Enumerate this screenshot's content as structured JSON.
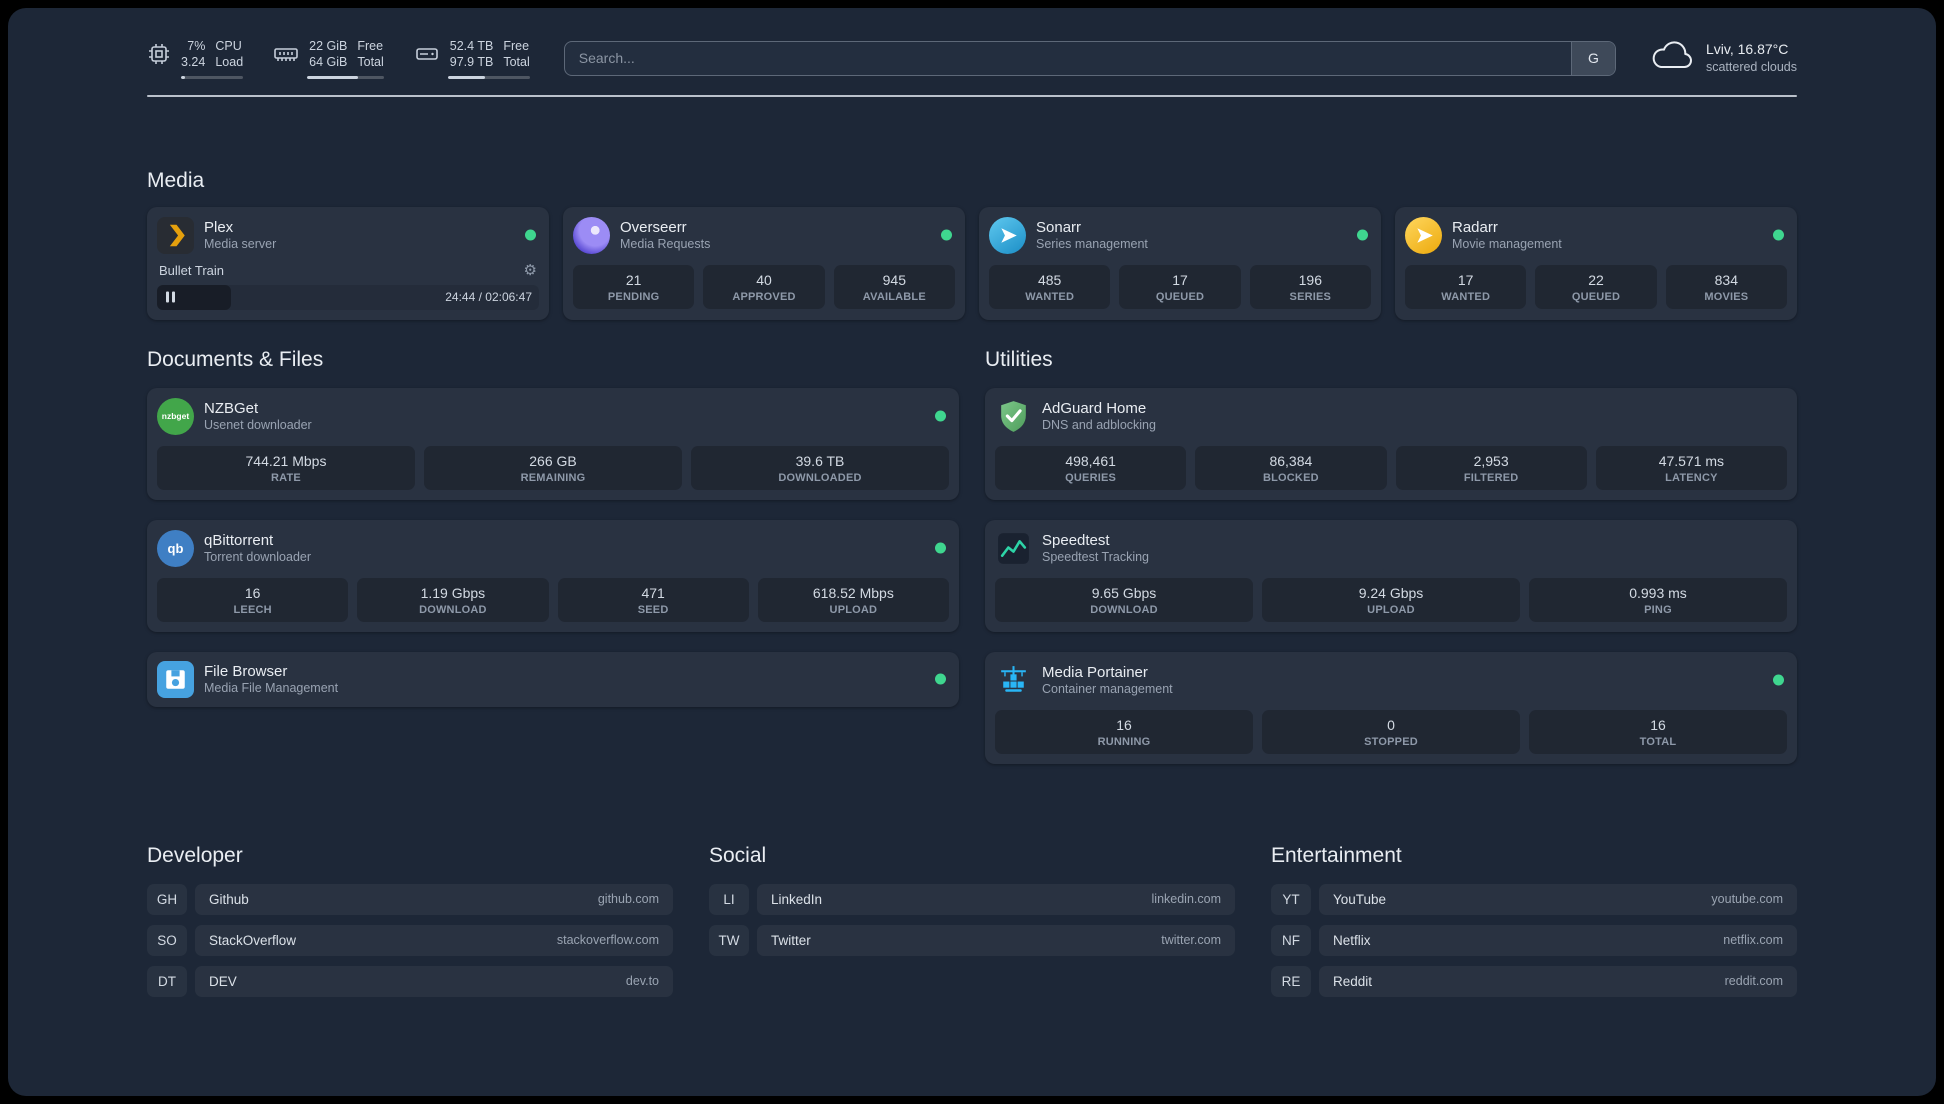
{
  "colors": {
    "background": "#1d2737",
    "card": "rgba(255,255,255,0.055)",
    "stat_box": "rgba(0,0,0,0.22)",
    "status_online": "#3fd68f",
    "text_primary": "#e9edf2",
    "text_secondary": "#99a3b2",
    "plex_amber": "#e5a00d",
    "overseerr_purple": "#5b4bd4",
    "sonarr_blue": "#35c5f4",
    "radarr_gold": "#f0b313",
    "nzbget_green": "#42a64a",
    "qbittorrent_blue": "#3f7fc4",
    "filebrowser_blue": "#46a2e0",
    "adguard_green": "#68bc71",
    "speedtest_green": "#2dd4a7",
    "portainer_blue": "#29b6f6"
  },
  "icons": {
    "cpu": "cpu-chip",
    "memory": "ram-stick",
    "disk": "hard-drive",
    "weather": "cloud",
    "settings": "gear",
    "pause": "pause-bars",
    "status": "green-dot",
    "nzbget_text": "nzbget",
    "qb_text": "qb"
  },
  "topbar": {
    "cpu": {
      "value1": "7%",
      "value2": "3.24",
      "label1": "CPU",
      "label2": "Load",
      "bar_pct": 7
    },
    "memory": {
      "value1": "22 GiB",
      "value2": "64 GiB",
      "label1": "Free",
      "label2": "Total",
      "bar_pct": 66
    },
    "disk": {
      "value1": "52.4 TB",
      "value2": "97.9 TB",
      "label1": "Free",
      "label2": "Total",
      "bar_pct": 46
    },
    "search": {
      "placeholder": "Search...",
      "button_label": "G"
    },
    "weather": {
      "location": "Lviv, 16.87°C",
      "condition": "scattered clouds"
    }
  },
  "sections": {
    "media": {
      "title": "Media",
      "plex": {
        "name": "Plex",
        "desc": "Media server",
        "status": "online",
        "player": {
          "title": "Bullet Train",
          "time": "24:44 / 02:06:47",
          "progress_pct": 19.5
        }
      },
      "overseerr": {
        "name": "Overseerr",
        "desc": "Media Requests",
        "status": "online",
        "stats": [
          {
            "value": "21",
            "label": "PENDING"
          },
          {
            "value": "40",
            "label": "APPROVED"
          },
          {
            "value": "945",
            "label": "AVAILABLE"
          }
        ]
      },
      "sonarr": {
        "name": "Sonarr",
        "desc": "Series management",
        "status": "online",
        "stats": [
          {
            "value": "485",
            "label": "WANTED"
          },
          {
            "value": "17",
            "label": "QUEUED"
          },
          {
            "value": "196",
            "label": "SERIES"
          }
        ]
      },
      "radarr": {
        "name": "Radarr",
        "desc": "Movie management",
        "status": "online",
        "stats": [
          {
            "value": "17",
            "label": "WANTED"
          },
          {
            "value": "22",
            "label": "QUEUED"
          },
          {
            "value": "834",
            "label": "MOVIES"
          }
        ]
      }
    },
    "documents": {
      "title": "Documents & Files",
      "nzbget": {
        "name": "NZBGet",
        "desc": "Usenet downloader",
        "status": "online",
        "stats": [
          {
            "value": "744.21 Mbps",
            "label": "RATE"
          },
          {
            "value": "266 GB",
            "label": "REMAINING"
          },
          {
            "value": "39.6 TB",
            "label": "DOWNLOADED"
          }
        ]
      },
      "qbittorrent": {
        "name": "qBittorrent",
        "desc": "Torrent downloader",
        "status": "online",
        "stats": [
          {
            "value": "16",
            "label": "LEECH"
          },
          {
            "value": "1.19 Gbps",
            "label": "DOWNLOAD"
          },
          {
            "value": "471",
            "label": "SEED"
          },
          {
            "value": "618.52 Mbps",
            "label": "UPLOAD"
          }
        ]
      },
      "filebrowser": {
        "name": "File Browser",
        "desc": "Media File Management",
        "status": "online"
      }
    },
    "utilities": {
      "title": "Utilities",
      "adguard": {
        "name": "AdGuard Home",
        "desc": "DNS and adblocking",
        "stats": [
          {
            "value": "498,461",
            "label": "QUERIES"
          },
          {
            "value": "86,384",
            "label": "BLOCKED"
          },
          {
            "value": "2,953",
            "label": "FILTERED"
          },
          {
            "value": "47.571 ms",
            "label": "LATENCY"
          }
        ]
      },
      "speedtest": {
        "name": "Speedtest",
        "desc": "Speedtest Tracking",
        "stats": [
          {
            "value": "9.65 Gbps",
            "label": "DOWNLOAD"
          },
          {
            "value": "9.24 Gbps",
            "label": "UPLOAD"
          },
          {
            "value": "0.993 ms",
            "label": "PING"
          }
        ]
      },
      "portainer": {
        "name": "Media Portainer",
        "desc": "Container management",
        "status": "online",
        "stats": [
          {
            "value": "16",
            "label": "RUNNING"
          },
          {
            "value": "0",
            "label": "STOPPED"
          },
          {
            "value": "16",
            "label": "TOTAL"
          }
        ]
      }
    },
    "bookmarks": {
      "developer": {
        "title": "Developer",
        "items": [
          {
            "abbr": "GH",
            "name": "Github",
            "domain": "github.com"
          },
          {
            "abbr": "SO",
            "name": "StackOverflow",
            "domain": "stackoverflow.com"
          },
          {
            "abbr": "DT",
            "name": "DEV",
            "domain": "dev.to"
          }
        ]
      },
      "social": {
        "title": "Social",
        "items": [
          {
            "abbr": "LI",
            "name": "LinkedIn",
            "domain": "linkedin.com"
          },
          {
            "abbr": "TW",
            "name": "Twitter",
            "domain": "twitter.com"
          }
        ]
      },
      "entertainment": {
        "title": "Entertainment",
        "items": [
          {
            "abbr": "YT",
            "name": "YouTube",
            "domain": "youtube.com"
          },
          {
            "abbr": "NF",
            "name": "Netflix",
            "domain": "netflix.com"
          },
          {
            "abbr": "RE",
            "name": "Reddit",
            "domain": "reddit.com"
          }
        ]
      }
    }
  }
}
